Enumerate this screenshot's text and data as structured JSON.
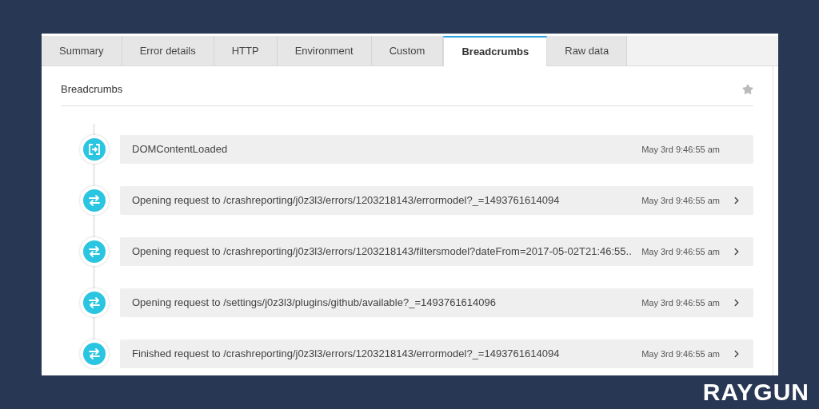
{
  "tabs": [
    {
      "label": "Summary",
      "selected": false
    },
    {
      "label": "Error details",
      "selected": false
    },
    {
      "label": "HTTP",
      "selected": false
    },
    {
      "label": "Environment",
      "selected": false
    },
    {
      "label": "Custom",
      "selected": false
    },
    {
      "label": "Breadcrumbs",
      "selected": true
    },
    {
      "label": "Raw data",
      "selected": false
    }
  ],
  "section": {
    "title": "Breadcrumbs"
  },
  "breadcrumbs": [
    {
      "kind": "navigation",
      "message": "DOMContentLoaded",
      "time": "May 3rd 9:46:55 am",
      "expandable": false
    },
    {
      "kind": "request",
      "message": "Opening request to /crashreporting/j0z3l3/errors/1203218143/errormodel?_=1493761614094",
      "time": "May 3rd 9:46:55 am",
      "expandable": true
    },
    {
      "kind": "request",
      "message": "Opening request to /crashreporting/j0z3l3/errors/1203218143/filtersmodel?dateFrom=2017-05-02T21:46:55..",
      "time": "May 3rd 9:46:55 am",
      "expandable": true
    },
    {
      "kind": "request",
      "message": "Opening request to /settings/j0z3l3/plugins/github/available?_=1493761614096",
      "time": "May 3rd 9:46:55 am",
      "expandable": true
    },
    {
      "kind": "request",
      "message": "Finished request to /crashreporting/j0z3l3/errors/1203218143/errormodel?_=1493761614094",
      "time": "May 3rd 9:46:55 am",
      "expandable": true
    }
  ],
  "logo": {
    "text": "RAYGUN"
  }
}
